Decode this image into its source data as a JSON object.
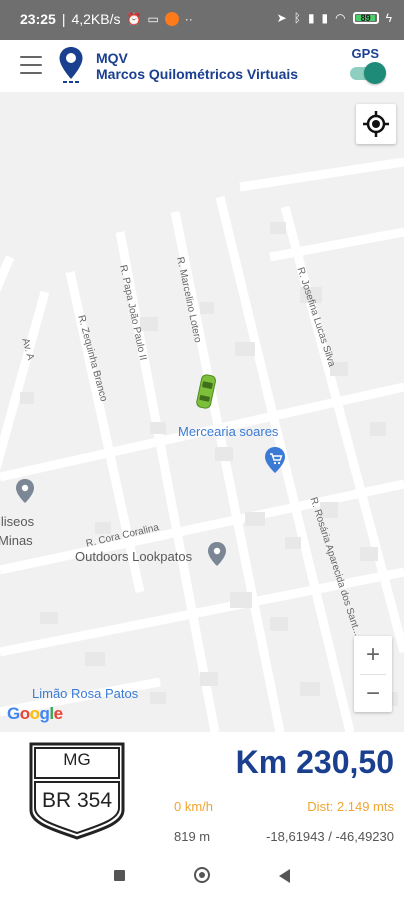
{
  "status_bar": {
    "time": "23:25",
    "net_speed": "4,2KB/s",
    "battery_level": "89"
  },
  "app_bar": {
    "title_short": "MQV",
    "title_full": "Marcos Quilométricos Virtuais",
    "gps_label": "GPS",
    "gps_enabled": true,
    "colors": {
      "primary": "#1a3f8f",
      "toggle_on": "#1e8a78"
    }
  },
  "map": {
    "streets": {
      "av_a": "Av. A",
      "zequinha_branco": "R. Zequinha Branco",
      "papa_joao": "R. Papa João Paulo II",
      "marcelino": "R. Marcelino Lotero",
      "josefina": "R. Josefina Lucas Silva",
      "cora": "R. Cora Coralina",
      "rosaria": "R. Rosária Aparecida dos Sant..."
    },
    "pois": {
      "mercearia": "Mercearia soares",
      "outdoors": "Outdoors Lookpatos",
      "limao": "Limão Rosa Patos",
      "iseos_line1": "iliseos",
      "iseos_line2": "Minas"
    },
    "zoom_in": "+",
    "zoom_out": "−",
    "google_logo": "Google"
  },
  "info": {
    "shield_state": "MG",
    "shield_road": "BR 354",
    "km_label": "Km 230,50",
    "speed": "0 km/h",
    "distance": "Dist: 2.149 mts",
    "altitude": "819 m",
    "coordinates": "-18,61943 / -46,49230",
    "colors": {
      "accent": "#f0a531",
      "primary": "#1a3f8f"
    }
  }
}
